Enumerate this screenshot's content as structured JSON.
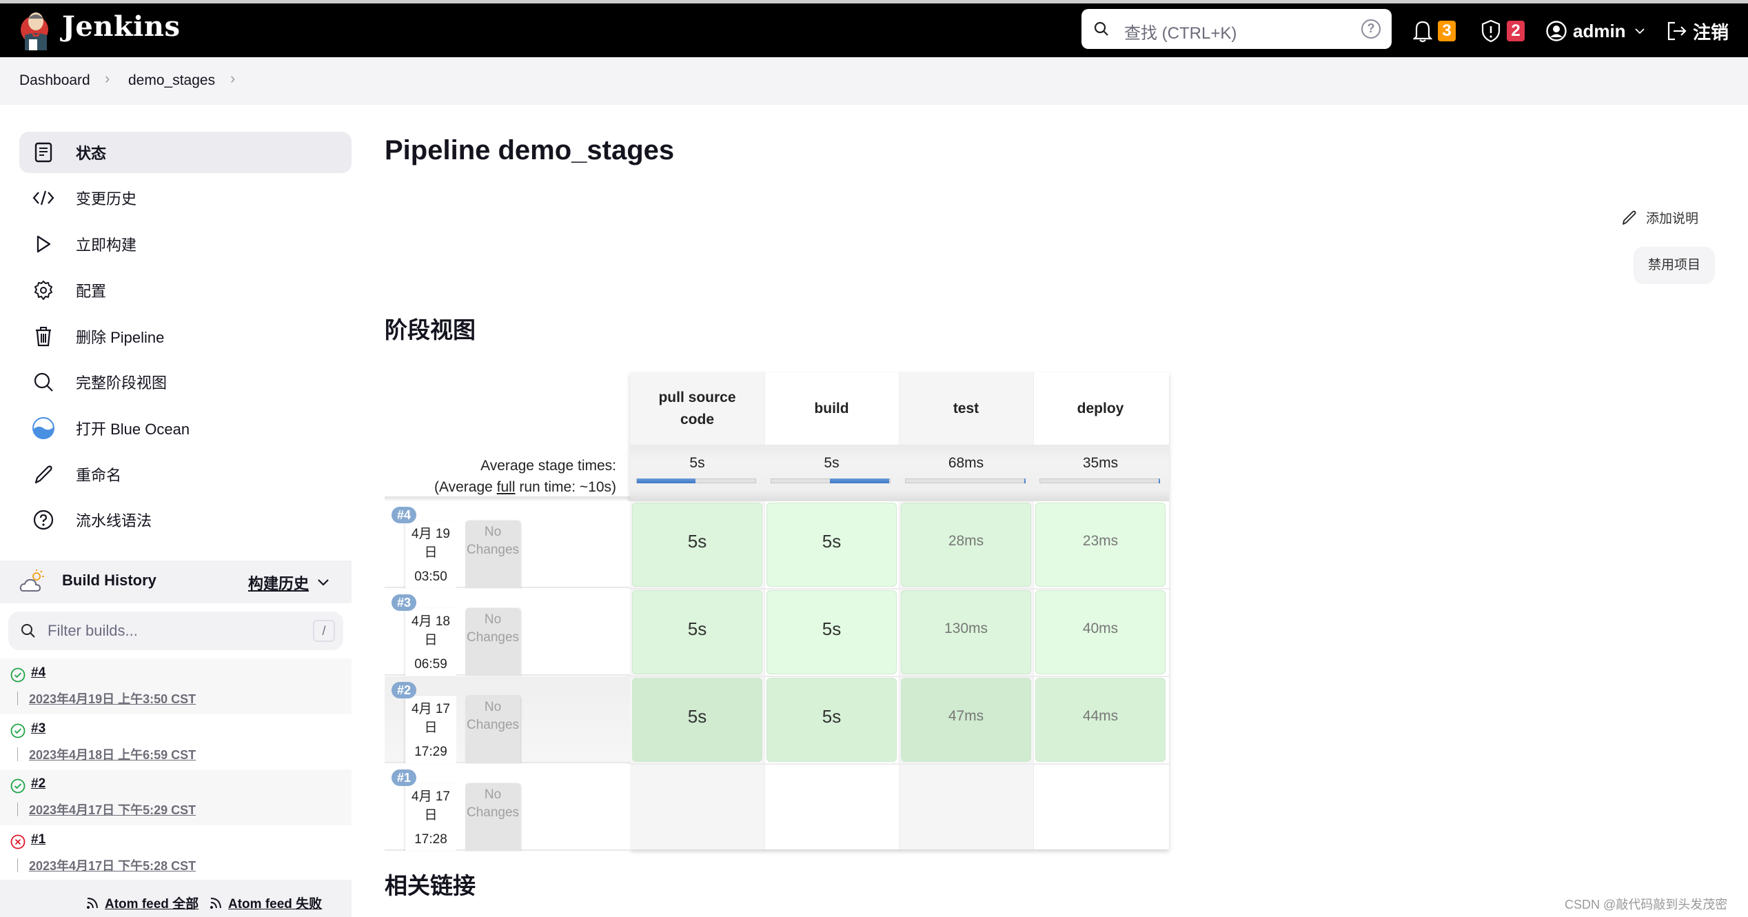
{
  "header": {
    "brand": "Jenkins",
    "search_placeholder": "查找 (CTRL+K)",
    "notifications_count": "3",
    "security_count": "2",
    "user": "admin",
    "logout": "注销",
    "colors": {
      "notif_badge": "#ff9900",
      "security_badge": "#e0364e"
    }
  },
  "breadcrumb": [
    "Dashboard",
    "demo_stages"
  ],
  "sidebar": {
    "items": [
      {
        "label": "状态",
        "icon": "document-icon",
        "active": true
      },
      {
        "label": "变更历史",
        "icon": "code-icon"
      },
      {
        "label": "立即构建",
        "icon": "play-icon"
      },
      {
        "label": "配置",
        "icon": "gear-icon"
      },
      {
        "label": "删除 Pipeline",
        "icon": "trash-icon"
      },
      {
        "label": "完整阶段视图",
        "icon": "search-icon"
      },
      {
        "label": "打开 Blue Ocean",
        "icon": "blue-ocean-icon"
      },
      {
        "label": "重命名",
        "icon": "pencil-icon"
      },
      {
        "label": "流水线语法",
        "icon": "help-icon"
      }
    ]
  },
  "build_history": {
    "title": "Build History",
    "link": "构建历史",
    "filter_placeholder": "Filter builds...",
    "filter_shortcut": "/",
    "builds": [
      {
        "number": "#4",
        "date": "2023年4月19日 上午3:50 CST",
        "status": "success"
      },
      {
        "number": "#3",
        "date": "2023年4月18日 上午6:59 CST",
        "status": "success"
      },
      {
        "number": "#2",
        "date": "2023年4月17日 下午5:29 CST",
        "status": "success"
      },
      {
        "number": "#1",
        "date": "2023年4月17日 下午5:28 CST",
        "status": "failed"
      }
    ],
    "feeds": [
      "Atom feed 全部",
      "Atom feed 失败"
    ]
  },
  "main": {
    "title": "Pipeline demo_stages",
    "add_description": "添加说明",
    "disable_button": "禁用项目",
    "stage_view_title": "阶段视图",
    "related_links_title": "相关链接"
  },
  "stage_view": {
    "avg_label_1": "Average stage times:",
    "avg_label_2_pre": "(Average ",
    "avg_label_2_link": "full",
    "avg_label_2_post": " run time: ~10s)",
    "stages": [
      {
        "name": "pull source code",
        "avg": "5s",
        "bar_start": 0,
        "bar_fraction": 0.49
      },
      {
        "name": "build",
        "avg": "5s",
        "bar_start": 0.49,
        "bar_fraction": 0.49
      },
      {
        "name": "test",
        "avg": "68ms",
        "bar_start": 0.99,
        "bar_fraction": 0.01
      },
      {
        "name": "deploy",
        "avg": "35ms",
        "bar_start": 0.99,
        "bar_fraction": 0.01
      }
    ],
    "runs": [
      {
        "badge": "#4",
        "date_line1": "4月 19",
        "date_line2": "日",
        "time": "03:50",
        "changes": "No Changes",
        "durations": [
          "5s",
          "5s",
          "28ms",
          "23ms"
        ]
      },
      {
        "badge": "#3",
        "date_line1": "4月 18",
        "date_line2": "日",
        "time": "06:59",
        "changes": "No Changes",
        "durations": [
          "5s",
          "5s",
          "130ms",
          "40ms"
        ]
      },
      {
        "badge": "#2",
        "date_line1": "4月 17",
        "date_line2": "日",
        "time": "17:29",
        "changes": "No Changes",
        "durations": [
          "5s",
          "5s",
          "47ms",
          "44ms"
        ]
      },
      {
        "badge": "#1",
        "date_line1": "4月 17",
        "date_line2": "日",
        "time": "17:28",
        "changes": "No Changes",
        "durations": []
      }
    ]
  },
  "watermark": "CSDN @敲代码敲到头发茂密"
}
